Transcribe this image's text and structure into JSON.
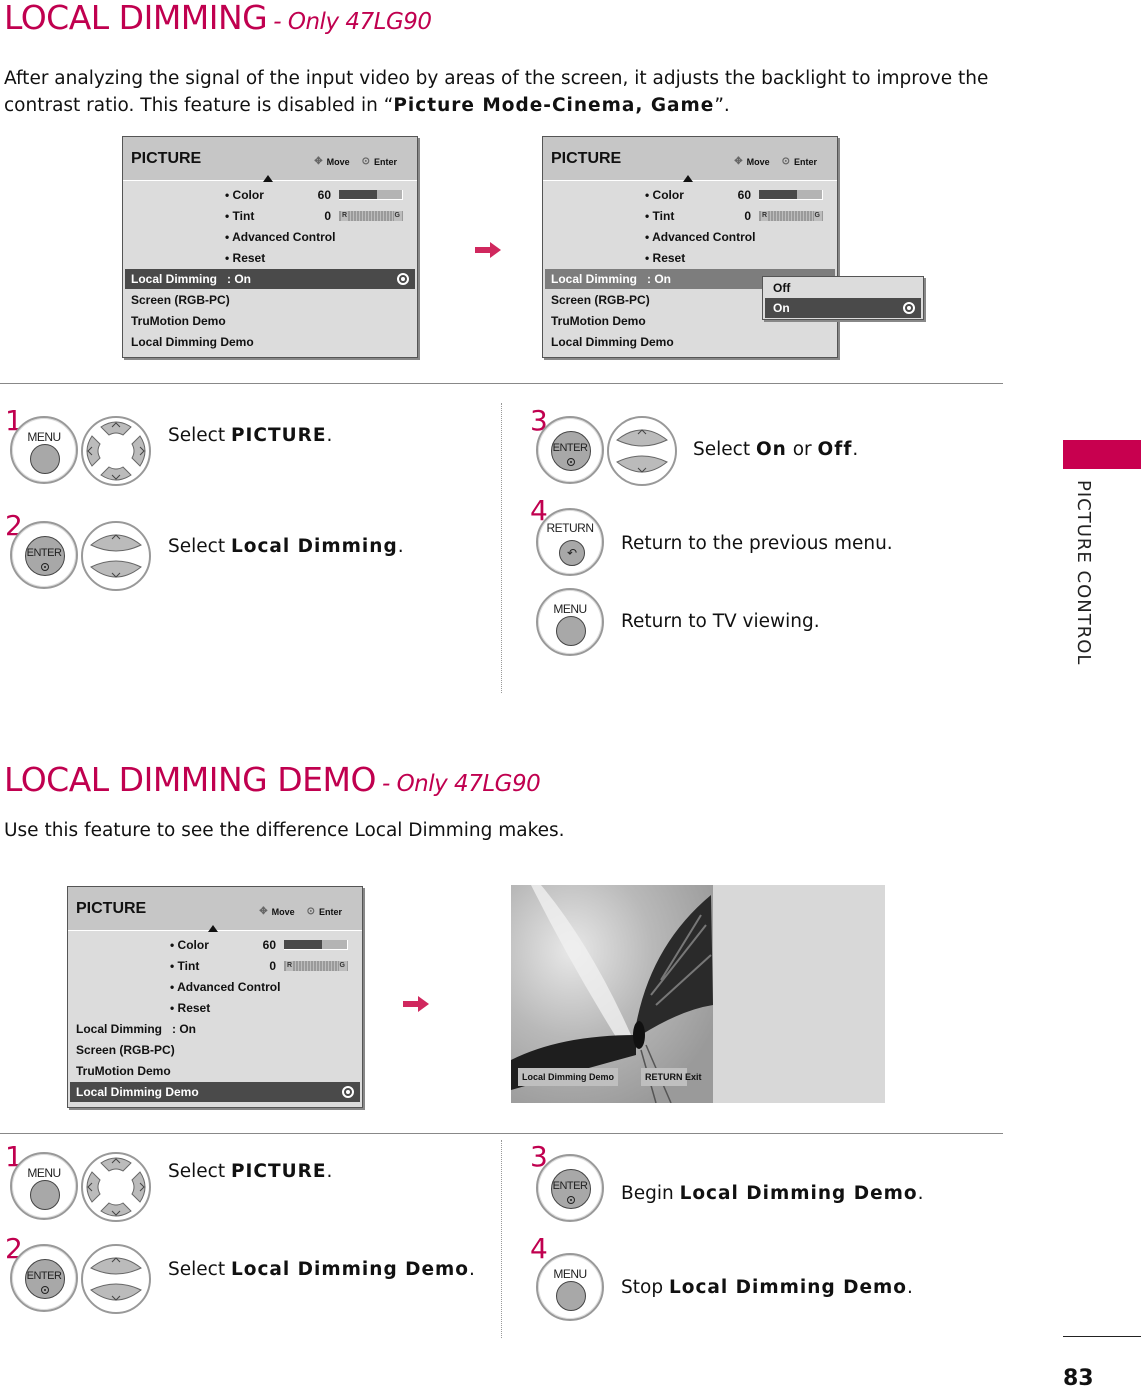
{
  "section1": {
    "title": "LOCAL DIMMING",
    "subtitle": "- Only 47LG90",
    "intro_line1": "After analyzing the signal of the input video by areas of the screen, it adjusts the backlight to improve the",
    "intro_line2_prefix": "contrast ratio. This feature is disabled in “",
    "intro_line2_bold": "Picture Mode-Cinema, Game",
    "intro_line2_suffix": "”."
  },
  "menu_common": {
    "title": "PICTURE",
    "hint_move": "Move",
    "hint_enter": "Enter",
    "items": {
      "color_label": "• Color",
      "color_value": "60",
      "color_level_percent": 60,
      "tint_label": "• Tint",
      "tint_value": "0",
      "tint_left": "R",
      "tint_right": "G",
      "advanced": "• Advanced Control",
      "reset": "• Reset",
      "local_dimming": "Local Dimming",
      "local_dimming_value": ": On",
      "screen": "Screen (RGB-PC)",
      "trumotion": "TruMotion Demo",
      "local_dimming_demo": "Local Dimming Demo"
    }
  },
  "popup": {
    "options": [
      "Off",
      "On"
    ],
    "selected": "On"
  },
  "steps1": [
    {
      "num": "1",
      "prefix": "Select ",
      "bold": "PICTURE",
      "suffix": "."
    },
    {
      "num": "2",
      "prefix": "Select ",
      "bold": "Local Dimming",
      "suffix": "."
    },
    {
      "num": "3",
      "prefix": "Select ",
      "bold": "On",
      "mid": " or ",
      "bold2": "Off",
      "suffix": "."
    },
    {
      "num": "4",
      "text": "Return to the previous menu."
    },
    {
      "text": "Return to TV viewing."
    }
  ],
  "section2": {
    "title": "LOCAL DIMMING DEMO",
    "subtitle": "- Only 47LG90",
    "intro": "Use this feature to see the difference Local Dimming makes."
  },
  "demo_screen": {
    "label": "Local Dimming Demo",
    "return_key": "RETURN",
    "exit": "Exit"
  },
  "steps2": [
    {
      "num": "1",
      "prefix": "Select ",
      "bold": "PICTURE",
      "suffix": "."
    },
    {
      "num": "2",
      "prefix": "Select ",
      "bold": "Local Dimming Demo",
      "suffix": "."
    },
    {
      "num": "3",
      "prefix": "Begin ",
      "bold": "Local Dimming Demo",
      "suffix": "."
    },
    {
      "num": "4",
      "prefix": "Stop ",
      "bold": "Local Dimming Demo",
      "suffix": "."
    }
  ],
  "buttons": {
    "menu": "MENU",
    "enter": "ENTER",
    "return": "RETURN"
  },
  "side_label": "PICTURE CONTROL",
  "page_number": "83",
  "colors": {
    "accent": "#c0004f",
    "menu_bg": "#dcdcdc",
    "menu_selected": "#4a4a4a"
  }
}
